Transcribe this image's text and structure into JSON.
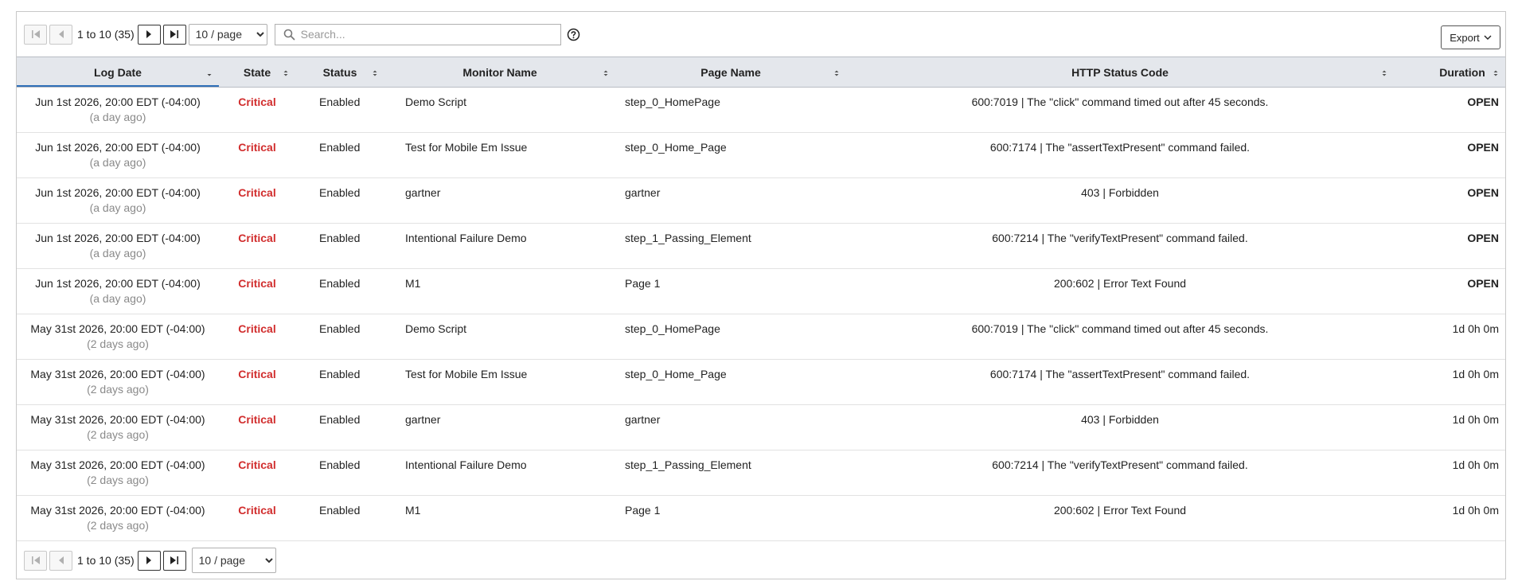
{
  "pager": {
    "range_text": "1 to 10 (35)",
    "page_size": "10 / page",
    "page_size_options": [
      "10 / page"
    ]
  },
  "search": {
    "placeholder": "Search..."
  },
  "export": {
    "label": "Export"
  },
  "columns": [
    {
      "label": "Log Date"
    },
    {
      "label": "State"
    },
    {
      "label": "Status"
    },
    {
      "label": "Monitor Name"
    },
    {
      "label": "Page Name"
    },
    {
      "label": "HTTP Status Code"
    },
    {
      "label": "Duration"
    }
  ],
  "colors": {
    "critical": "#d12d2d",
    "sort_active": "#2f6fb8",
    "header_bg": "#e4e7ec"
  },
  "rows": [
    {
      "date": "Jun 1st 2026, 20:00 EDT (-04:00)",
      "ago": "(a day ago)",
      "state": "Critical",
      "status": "Enabled",
      "monitor": "Demo Script",
      "page": "step_0_HomePage",
      "http": "600:7019 | The \"click\" command timed out after 45 seconds.",
      "duration": "OPEN"
    },
    {
      "date": "Jun 1st 2026, 20:00 EDT (-04:00)",
      "ago": "(a day ago)",
      "state": "Critical",
      "status": "Enabled",
      "monitor": "Test for Mobile Em Issue",
      "page": "step_0_Home_Page",
      "http": "600:7174 | The \"assertTextPresent\" command failed.",
      "duration": "OPEN"
    },
    {
      "date": "Jun 1st 2026, 20:00 EDT (-04:00)",
      "ago": "(a day ago)",
      "state": "Critical",
      "status": "Enabled",
      "monitor": "gartner",
      "page": "gartner",
      "http": "403 | Forbidden",
      "duration": "OPEN"
    },
    {
      "date": "Jun 1st 2026, 20:00 EDT (-04:00)",
      "ago": "(a day ago)",
      "state": "Critical",
      "status": "Enabled",
      "monitor": "Intentional Failure Demo",
      "page": "step_1_Passing_Element",
      "http": "600:7214 | The \"verifyTextPresent\" command failed.",
      "duration": "OPEN"
    },
    {
      "date": "Jun 1st 2026, 20:00 EDT (-04:00)",
      "ago": "(a day ago)",
      "state": "Critical",
      "status": "Enabled",
      "monitor": "M1",
      "page": "Page 1",
      "http": "200:602 | Error Text Found",
      "duration": "OPEN"
    },
    {
      "date": "May 31st 2026, 20:00 EDT (-04:00)",
      "ago": "(2 days ago)",
      "state": "Critical",
      "status": "Enabled",
      "monitor": "Demo Script",
      "page": "step_0_HomePage",
      "http": "600:7019 | The \"click\" command timed out after 45 seconds.",
      "duration": "1d 0h 0m"
    },
    {
      "date": "May 31st 2026, 20:00 EDT (-04:00)",
      "ago": "(2 days ago)",
      "state": "Critical",
      "status": "Enabled",
      "monitor": "Test for Mobile Em Issue",
      "page": "step_0_Home_Page",
      "http": "600:7174 | The \"assertTextPresent\" command failed.",
      "duration": "1d 0h 0m"
    },
    {
      "date": "May 31st 2026, 20:00 EDT (-04:00)",
      "ago": "(2 days ago)",
      "state": "Critical",
      "status": "Enabled",
      "monitor": "gartner",
      "page": "gartner",
      "http": "403 | Forbidden",
      "duration": "1d 0h 0m"
    },
    {
      "date": "May 31st 2026, 20:00 EDT (-04:00)",
      "ago": "(2 days ago)",
      "state": "Critical",
      "status": "Enabled",
      "monitor": "Intentional Failure Demo",
      "page": "step_1_Passing_Element",
      "http": "600:7214 | The \"verifyTextPresent\" command failed.",
      "duration": "1d 0h 0m"
    },
    {
      "date": "May 31st 2026, 20:00 EDT (-04:00)",
      "ago": "(2 days ago)",
      "state": "Critical",
      "status": "Enabled",
      "monitor": "M1",
      "page": "Page 1",
      "http": "200:602 | Error Text Found",
      "duration": "1d 0h 0m"
    }
  ]
}
